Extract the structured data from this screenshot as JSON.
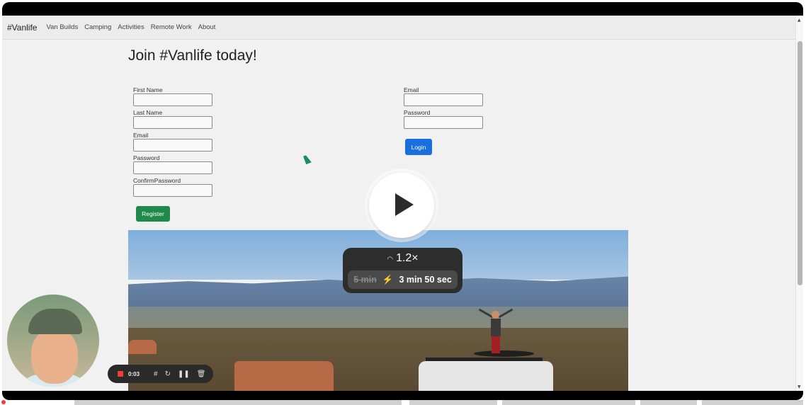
{
  "navbar": {
    "brand": "#Vanlife",
    "links": [
      "Van Builds",
      "Camping",
      "Activities",
      "Remote Work",
      "About"
    ]
  },
  "page": {
    "title": "Join #Vanlife today!"
  },
  "register_form": {
    "fields": [
      {
        "label": "First Name",
        "value": ""
      },
      {
        "label": "Last Name",
        "value": ""
      },
      {
        "label": "Email",
        "value": ""
      },
      {
        "label": "Password",
        "value": ""
      },
      {
        "label": "ConfirmPassword",
        "value": ""
      }
    ],
    "submit_label": "Register"
  },
  "login_form": {
    "fields": [
      {
        "label": "Email",
        "value": ""
      },
      {
        "label": "Password",
        "value": ""
      }
    ],
    "submit_label": "Login"
  },
  "video_overlay": {
    "speed": "1.2×",
    "original_duration": "5 min",
    "new_duration": "3 min 50 sec"
  },
  "recorder": {
    "elapsed": "0:03"
  },
  "colors": {
    "register_button": "#1f8a4c",
    "login_button": "#1a6fe0",
    "record_indicator": "#e8413b"
  }
}
